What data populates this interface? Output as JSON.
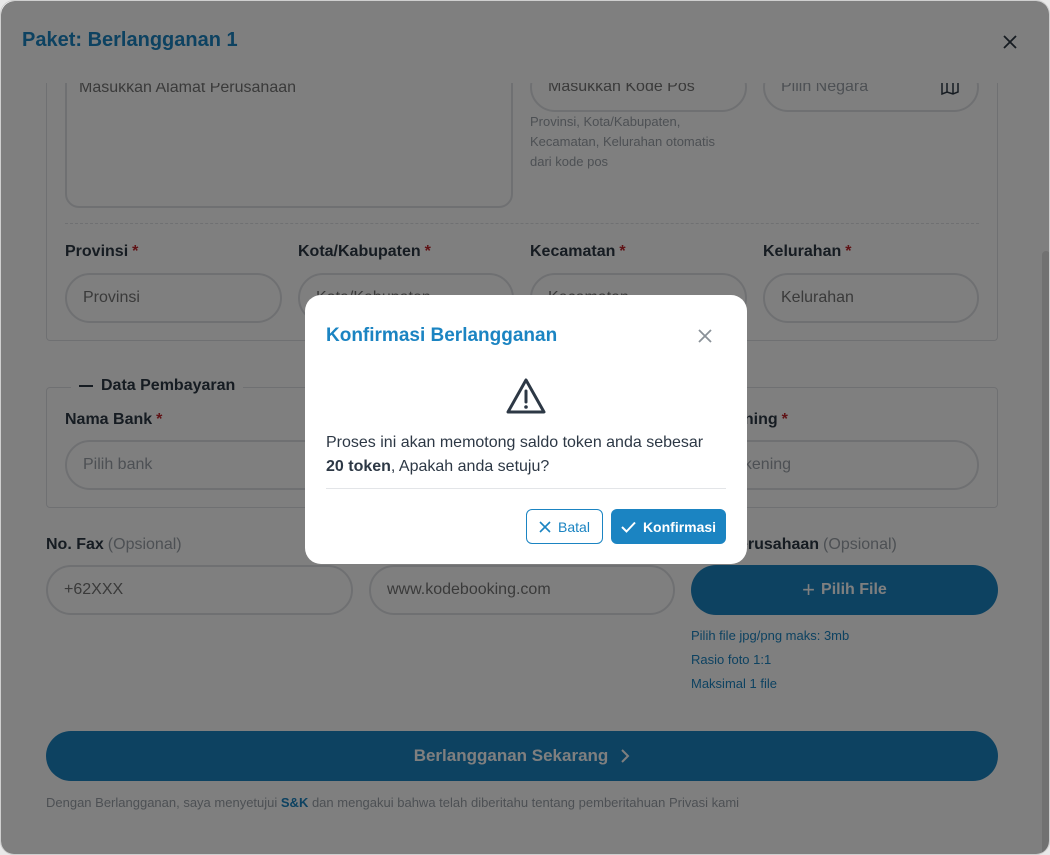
{
  "header": {
    "title": "Paket: Berlangganan 1"
  },
  "address": {
    "placeholder": "Masukkan Alamat Perusahaan",
    "postal_placeholder": "Masukkan Kode Pos",
    "postal_hint": [
      "Provinsi, Kota/Kabupaten,",
      "Kecamatan, Kelurahan otomatis",
      "dari kode pos"
    ],
    "country_placeholder": "Pilih Negara"
  },
  "region": {
    "province_label": "Provinsi",
    "province_placeholder": "Provinsi",
    "city_label": "Kota/Kabupaten",
    "city_placeholder": "Kota/Kabupaten",
    "district_label": "Kecamatan",
    "district_placeholder": "Kecamatan",
    "village_label": "Kelurahan",
    "village_placeholder": "Kelurahan",
    "required_mark": "*"
  },
  "payment": {
    "legend": "Data Pembayaran",
    "bank_label": "Nama Bank",
    "bank_placeholder": "Pilih bank",
    "account_label_visible": "ening",
    "account_placeholder_visible": "ekening"
  },
  "contact": {
    "fax_label": "No. Fax",
    "optional": "(Opsional)",
    "fax_placeholder": "+62XXX",
    "website_placeholder": "www.kodebooking.com",
    "logo_label_visible": "erusahaan",
    "file_button": "Pilih File",
    "file_hints": [
      "Pilih file jpg/png maks: 3mb",
      "Rasio foto 1:1",
      "Maksimal 1 file"
    ]
  },
  "subscribe": {
    "button": "Berlangganan Sekarang",
    "footer_before": "Dengan Berlangganan, saya menyetujui ",
    "footer_link": "S&K",
    "footer_after": " dan mengakui bahwa telah diberitahu tentang pemberitahuan Privasi kami"
  },
  "modal": {
    "title": "Konfirmasi Berlangganan",
    "message_before": "Proses ini akan memotong saldo token anda sebesar",
    "message_bold": "20 token",
    "message_after": ", Apakah anda setuju?",
    "cancel": "Batal",
    "confirm": "Konfirmasi"
  },
  "colors": {
    "accent": "#1b84c2",
    "required": "#c0262d",
    "muted": "#9aa1a8",
    "text": "#2d3845"
  },
  "icons": {
    "close": "close-icon",
    "warning": "warning-icon",
    "map": "map-icon",
    "plus": "plus-icon",
    "chevron": "chevron-right-icon",
    "check": "check-icon"
  }
}
